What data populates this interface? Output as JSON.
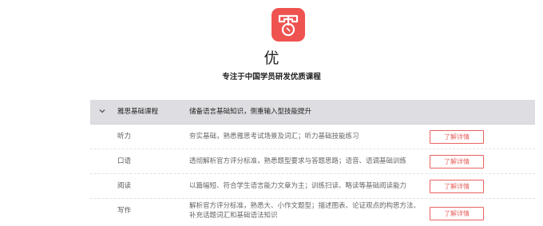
{
  "brand": {
    "name": "优",
    "tagline": "专注于中国学员研发优质课程",
    "accent": "#ef5350"
  },
  "course_table": {
    "header": {
      "icon": "chevron-down-icon",
      "name": "雅思基础课程",
      "desc": "储备语言基础知识，侧重输入型技能提升"
    },
    "rows": [
      {
        "name": "听力",
        "desc": "夯实基础，熟悉雅思考试场景及词汇；听力基础技能练习",
        "button": "了解详情"
      },
      {
        "name": "口语",
        "desc": "透彻解析官方评分标准，熟悉题型要求与答题思路；语音、语调基础训练",
        "button": "了解详情"
      },
      {
        "name": "阅读",
        "desc": "以篇幅短、符合学生语言能力文章为主；训练扫读、略读等基础阅读能力",
        "button": "了解详情"
      },
      {
        "name": "写作",
        "desc": "解析官方评分标准，熟悉大、小作文题型；描述图表、论证观点的构思方法、补充话题词汇和基础语法知识",
        "button": "了解详情"
      }
    ]
  }
}
